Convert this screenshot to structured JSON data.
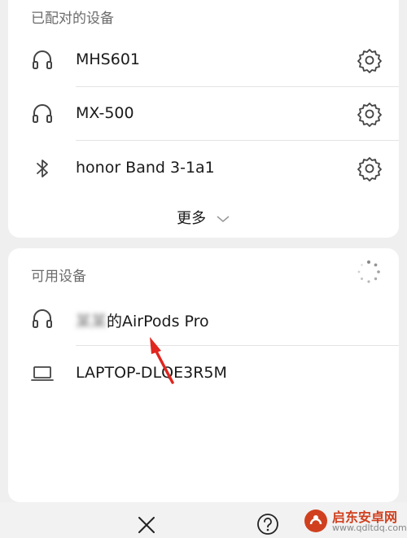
{
  "paired": {
    "title": "已配对的设备",
    "devices": [
      {
        "name": "MHS601",
        "icon": "headphones-icon"
      },
      {
        "name": "MX-500",
        "icon": "headphones-icon"
      },
      {
        "name": "honor Band 3-1a1",
        "icon": "bluetooth-icon"
      }
    ],
    "more_label": "更多"
  },
  "available": {
    "title": "可用设备",
    "devices": [
      {
        "name_blurred": "某某",
        "name": "的AirPods Pro",
        "icon": "headphones-icon"
      },
      {
        "name": "LAPTOP-DLQE3R5M",
        "icon": "laptop-icon"
      }
    ]
  },
  "watermark": {
    "text": "启东安卓网",
    "url": "www.qdltdq.com"
  },
  "colors": {
    "accent_arrow": "#e0261f",
    "watermark": "#d0401f"
  }
}
